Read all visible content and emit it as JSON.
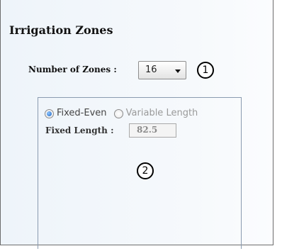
{
  "panel": {
    "title": "Irrigation Zones"
  },
  "zones": {
    "label": "Number of Zones :",
    "selected": "16",
    "callout": "1"
  },
  "length_mode": {
    "options": [
      {
        "label": "Fixed-Even",
        "checked": true
      },
      {
        "label": "Variable Length",
        "checked": false
      }
    ],
    "fixed_length_label": "Fixed Length :",
    "fixed_length_value": "82.5",
    "callout": "2"
  },
  "icons": {
    "dropdown": "chevron-down-icon",
    "radio": "radio-button-icon"
  },
  "colors": {
    "radio_selected": "#1f66c2",
    "panel_background": "#eef4fa",
    "group_border": "#8a9bb0"
  }
}
